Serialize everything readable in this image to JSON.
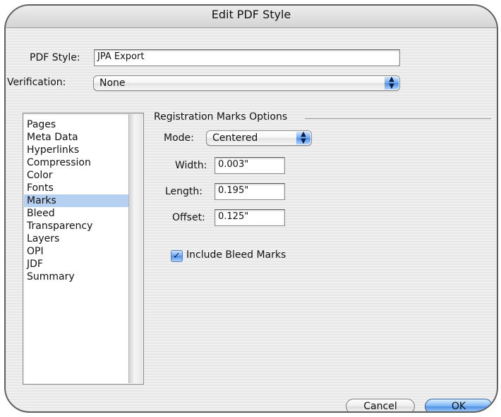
{
  "window": {
    "title": "Edit PDF Style"
  },
  "fields": {
    "pdf_style": {
      "label": "PDF Style:",
      "value": "JPA Export"
    },
    "verification": {
      "label": "Verification:",
      "value": "None"
    }
  },
  "sidebar": {
    "items": [
      {
        "label": "Pages",
        "selected": false
      },
      {
        "label": "Meta Data",
        "selected": false
      },
      {
        "label": "Hyperlinks",
        "selected": false
      },
      {
        "label": "Compression",
        "selected": false
      },
      {
        "label": "Color",
        "selected": false
      },
      {
        "label": "Fonts",
        "selected": false
      },
      {
        "label": "Marks",
        "selected": true
      },
      {
        "label": "Bleed",
        "selected": false
      },
      {
        "label": "Transparency",
        "selected": false
      },
      {
        "label": "Layers",
        "selected": false
      },
      {
        "label": "OPI",
        "selected": false
      },
      {
        "label": "JDF",
        "selected": false
      },
      {
        "label": "Summary",
        "selected": false
      }
    ]
  },
  "marks": {
    "group_title": "Registration Marks Options",
    "mode": {
      "label": "Mode:",
      "value": "Centered"
    },
    "width": {
      "label": "Width:",
      "value": "0.003\""
    },
    "length": {
      "label": "Length:",
      "value": "0.195\""
    },
    "offset": {
      "label": "Offset:",
      "value": "0.125\""
    },
    "include_bleed": {
      "label": "Include Bleed Marks",
      "checked": true
    }
  },
  "buttons": {
    "cancel": "Cancel",
    "ok": "OK"
  },
  "colors": {
    "selection": "#b6d0f1",
    "accent": "#4d8ee6"
  }
}
